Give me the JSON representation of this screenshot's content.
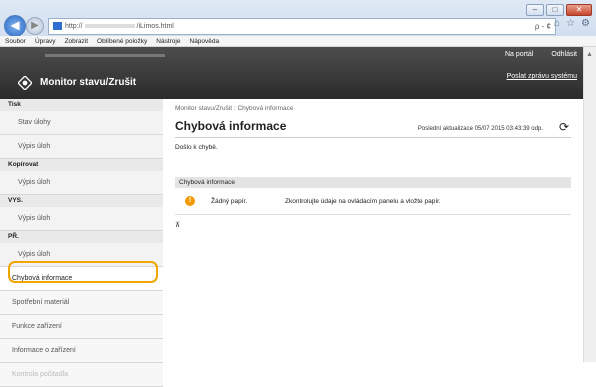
{
  "browser": {
    "url": "http://",
    "url_tail": "/iLimos.html",
    "search_controls": "ρ - ¢",
    "menu": [
      "Soubor",
      "Úpravy",
      "Zobrazit",
      "Oblíbené položky",
      "Nástroje",
      "Nápověda"
    ]
  },
  "header": {
    "title": "Monitor stavu/Zrušit",
    "link_portal": "Na portál",
    "link_logout": "Odhlásit",
    "link_mail": "Poslat zprávu systému"
  },
  "sidebar": {
    "groups": [
      {
        "section": "Tisk",
        "items": [
          "Stav úlohy",
          "Výpis úloh"
        ]
      },
      {
        "section": "Kopírovat",
        "items": [
          "Výpis úloh"
        ]
      },
      {
        "section": "VYS.",
        "items": [
          "Výpis úloh"
        ]
      },
      {
        "section": "PŘ.",
        "items": [
          "Výpis úloh"
        ]
      }
    ],
    "extra": [
      "Chybová informace",
      "Spotřební materiál",
      "Funkce zařízení",
      "Informace o zařízení",
      "Kontrola počitadla"
    ]
  },
  "main": {
    "breadcrumb": "Monitor stavu/Zrušit : Chybová informace",
    "title": "Chybová informace",
    "update": "Poslední aktualizace 05/07 2015 03:43:39 odp.",
    "note": "Došlo k chybě.",
    "box_title": "Chybová informace",
    "error_name": "Žádný papír.",
    "error_desc": "Zkontrolujte údaje na ovládacím panelu a vložte papír.",
    "to_top": "⊼"
  }
}
